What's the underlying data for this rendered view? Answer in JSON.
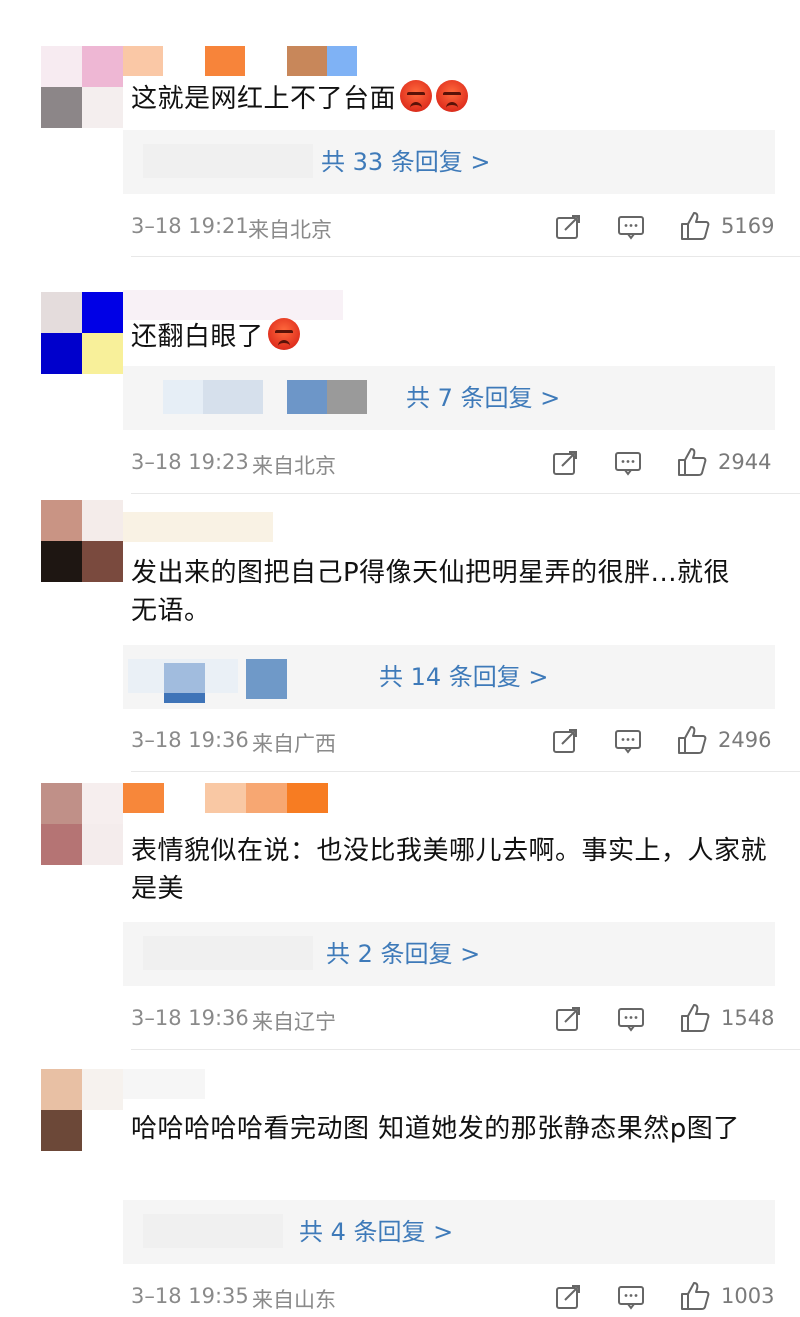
{
  "comments": [
    {
      "text": "这就是网红上不了台面",
      "emoji_count": 2,
      "reply_label": "共 33 条回复 >",
      "time": "3–18 19:21",
      "location": "来自北京",
      "likes": "5169"
    },
    {
      "text": "还翻白眼了",
      "emoji_count": 1,
      "reply_label": "共 7 条回复 >",
      "time": "3–18 19:23",
      "location": "来自北京",
      "likes": "2944"
    },
    {
      "text": "发出来的图把自己P得像天仙把明星弄的很胖...就很无语。",
      "emoji_count": 0,
      "reply_label": "共 14 条回复 >",
      "time": "3–18 19:36",
      "location": "来自广西",
      "likes": "2496"
    },
    {
      "text": "表情貌似在说：也没比我美哪儿去啊。事实上，人家就是美",
      "emoji_count": 0,
      "reply_label": "共 2 条回复 >",
      "time": "3–18 19:36",
      "location": "来自辽宁",
      "likes": "1548"
    },
    {
      "text": "哈哈哈哈哈看完动图 知道她发的那张静态果然p图了",
      "emoji_count": 0,
      "reply_label": "共 4 条回复 >",
      "time": "3–18 19:35",
      "location": "来自山东",
      "likes": "1003"
    }
  ],
  "icons": {
    "share": "share-icon",
    "comment": "comment-icon",
    "like": "thumbs-up-icon",
    "emoji": "angry-face-emoji"
  },
  "colors": {
    "link": "#3e7ab9",
    "meta": "#8a8a8a",
    "reply_bg": "#f5f5f5",
    "divider": "#e8e8e8"
  }
}
